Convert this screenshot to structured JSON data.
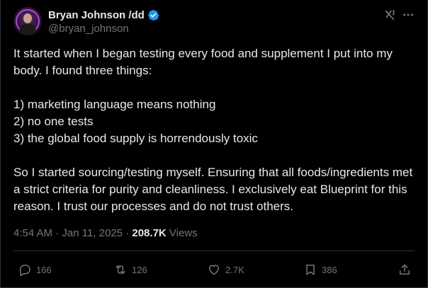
{
  "author": {
    "display_name": "Bryan Johnson /dd",
    "handle": "@bryan_johnson",
    "verified": true
  },
  "colors": {
    "background": "#000000",
    "text_primary": "#e7e9ea",
    "text_secondary": "#71767b",
    "verified_badge": "#1d9bf0",
    "border": "#2f3336"
  },
  "icons": {
    "grok": "grok-icon",
    "more": "more-icon",
    "verified": "verified-badge-icon"
  },
  "post": {
    "paragraphs": [
      "It started when I began testing every food and supplement I put into my body. I found three things:",
      "",
      "1) marketing language means nothing",
      "2) no one tests",
      "3) the global food supply is horrendously toxic",
      "",
      "So I started sourcing/testing myself. Ensuring that all foods/ingredients met a strict criteria for purity and cleanliness. I exclusively eat Blueprint for this reason. I trust our processes and do not trust others."
    ]
  },
  "meta": {
    "time": "4:54 AM",
    "separator_1": " · ",
    "date": "Jan 11, 2025",
    "separator_2": " · ",
    "views_count": "208.7K",
    "views_label": " Views"
  },
  "actions": {
    "reply": {
      "icon": "reply-icon",
      "count": "166"
    },
    "repost": {
      "icon": "repost-icon",
      "count": "126"
    },
    "like": {
      "icon": "heart-icon",
      "count": "2.7K"
    },
    "bookmark": {
      "icon": "bookmark-icon",
      "count": "386"
    },
    "share": {
      "icon": "share-icon"
    }
  }
}
